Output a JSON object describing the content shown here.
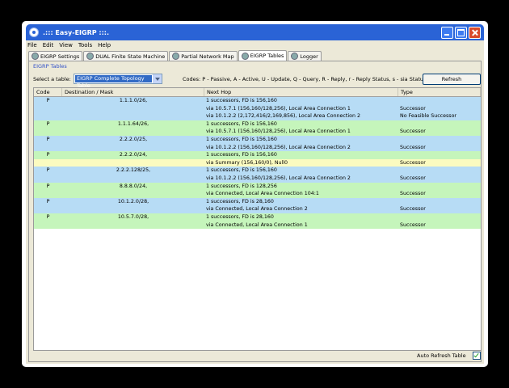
{
  "window": {
    "title": ".::: Easy-EIGRP :::."
  },
  "menu": [
    "File",
    "Edit",
    "View",
    "Tools",
    "Help"
  ],
  "tabs": [
    {
      "label": "EIGRP Settings",
      "icon": "gear-icon",
      "active": false
    },
    {
      "label": "DUAL Finite State Machine",
      "icon": "gear-icon",
      "active": false
    },
    {
      "label": "Partial Network Map",
      "icon": "map-icon",
      "active": false
    },
    {
      "label": "EIGRP Tables",
      "icon": "table-icon",
      "active": true
    },
    {
      "label": "Logger",
      "icon": "log-icon",
      "active": false
    }
  ],
  "panel": {
    "section_label": "EIGRP Tables",
    "select_label": "Select a table:",
    "selected_table": "EIGRP Complete Topology Table",
    "codes": "Codes: P - Passive, A - Active, U - Update, Q - Query, R - Reply, r - Reply Status, s - sia Status",
    "refresh_label": "Refresh",
    "auto_refresh_label": "Auto Refresh Table",
    "auto_refresh_checked": true
  },
  "table": {
    "headers": [
      "Code",
      "Destination / Mask",
      "Next Hop",
      "Type"
    ],
    "rows": [
      {
        "color": "blue",
        "code": "P",
        "dest": "1.1.1.0/26,",
        "hop": "1 successors, FD is 156,160",
        "type": ""
      },
      {
        "color": "blue",
        "code": "",
        "dest": "",
        "hop": "via 10.5.7.1 (156,160/128,256),  Local Area Connection 1",
        "type": "Successor"
      },
      {
        "color": "blue",
        "code": "",
        "dest": "",
        "hop": "via 10.1.2.2 (2,172,416/2,169,856),  Local Area Connection 2",
        "type": "No Feasible Successor"
      },
      {
        "color": "green",
        "code": "P",
        "dest": "1.1.1.64/26,",
        "hop": "1 successors, FD is 156,160",
        "type": ""
      },
      {
        "color": "green",
        "code": "",
        "dest": "",
        "hop": "via 10.5.7.1 (156,160/128,256),  Local Area Connection 1",
        "type": "Successor"
      },
      {
        "color": "blue",
        "code": "P",
        "dest": "2.2.2.0/25,",
        "hop": "1 successors, FD is 156,160",
        "type": ""
      },
      {
        "color": "blue",
        "code": "",
        "dest": "",
        "hop": "via 10.1.2.2 (156,160/128,256),  Local Area Connection 2",
        "type": "Successor"
      },
      {
        "color": "green",
        "code": "P",
        "dest": "2.2.2.0/24,",
        "hop": "1 successors, FD is 156,160",
        "type": ""
      },
      {
        "color": "yellow",
        "code": "",
        "dest": "",
        "hop": "via Summary (156,160/0), Null0",
        "type": "Successor"
      },
      {
        "color": "blue",
        "code": "P",
        "dest": "2.2.2.128/25,",
        "hop": "1 successors, FD is 156,160",
        "type": ""
      },
      {
        "color": "blue",
        "code": "",
        "dest": "",
        "hop": "via 10.1.2.2 (156,160/128,256),  Local Area Connection 2",
        "type": "Successor"
      },
      {
        "color": "green",
        "code": "P",
        "dest": "8.8.8.0/24,",
        "hop": "1 successors, FD is 128,256",
        "type": ""
      },
      {
        "color": "green",
        "code": "",
        "dest": "",
        "hop": "via Connected, Local Area Connection 104:1",
        "type": "Successor"
      },
      {
        "color": "blue",
        "code": "P",
        "dest": "10.1.2.0/28,",
        "hop": "1 successors, FD is 28,160",
        "type": ""
      },
      {
        "color": "blue",
        "code": "",
        "dest": "",
        "hop": "via Connected, Local Area Connection 2",
        "type": "Successor"
      },
      {
        "color": "green",
        "code": "P",
        "dest": "10.5.7.0/28,",
        "hop": "1 successors, FD is 28,160",
        "type": ""
      },
      {
        "color": "green",
        "code": "",
        "dest": "",
        "hop": "via Connected, Local Area Connection 1",
        "type": "Successor"
      }
    ]
  }
}
